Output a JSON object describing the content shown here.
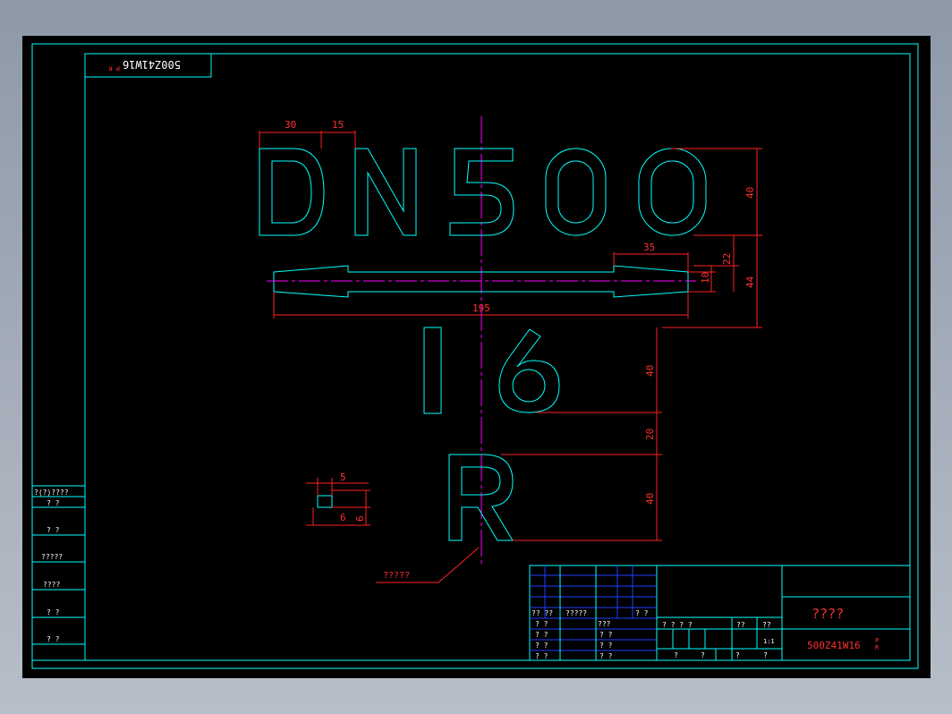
{
  "drawing": {
    "top_label": "500Z41W16",
    "top_label_sub": "P R",
    "title_main": "DN500",
    "title_pressure": "16",
    "title_letter": "R",
    "leader_note": "?????"
  },
  "dimensions": {
    "d30": "30",
    "d15": "15",
    "d40a": "40",
    "d35": "35",
    "d22": "22",
    "d44": "44",
    "d10": "10",
    "d195": "195",
    "d40b": "40",
    "d20": "20",
    "d40c": "40",
    "d5": "5",
    "d6a": "6",
    "d6b": "6"
  },
  "left_table": {
    "header": "?(?)????",
    "rows": [
      "?  ?",
      "?  ?",
      "?????",
      "????",
      "?  ?",
      "?  ?"
    ]
  },
  "title_block": {
    "big_title": "????",
    "drawing_no": "500Z41W16",
    "drawing_no_sub": "P R",
    "row_labels": [
      "??  ??",
      "?????",
      "?  ?"
    ],
    "left_cells": [
      "? ?",
      "? ?",
      "? ?",
      "? ?"
    ],
    "mid_cells": [
      "???",
      "? ?",
      "? ?",
      "? ?"
    ],
    "stage_label": "? ? ? ?",
    "mass_label": "??",
    "scale_label": "??",
    "scale_value": "1:1",
    "bottom_cells": [
      "?",
      "?",
      "?",
      "?"
    ]
  },
  "colors": {
    "background": "#000000",
    "outline": "#00ffff",
    "dimension": "#ff2020",
    "centerline": "#ff00ff",
    "grid": "#2040ff"
  }
}
